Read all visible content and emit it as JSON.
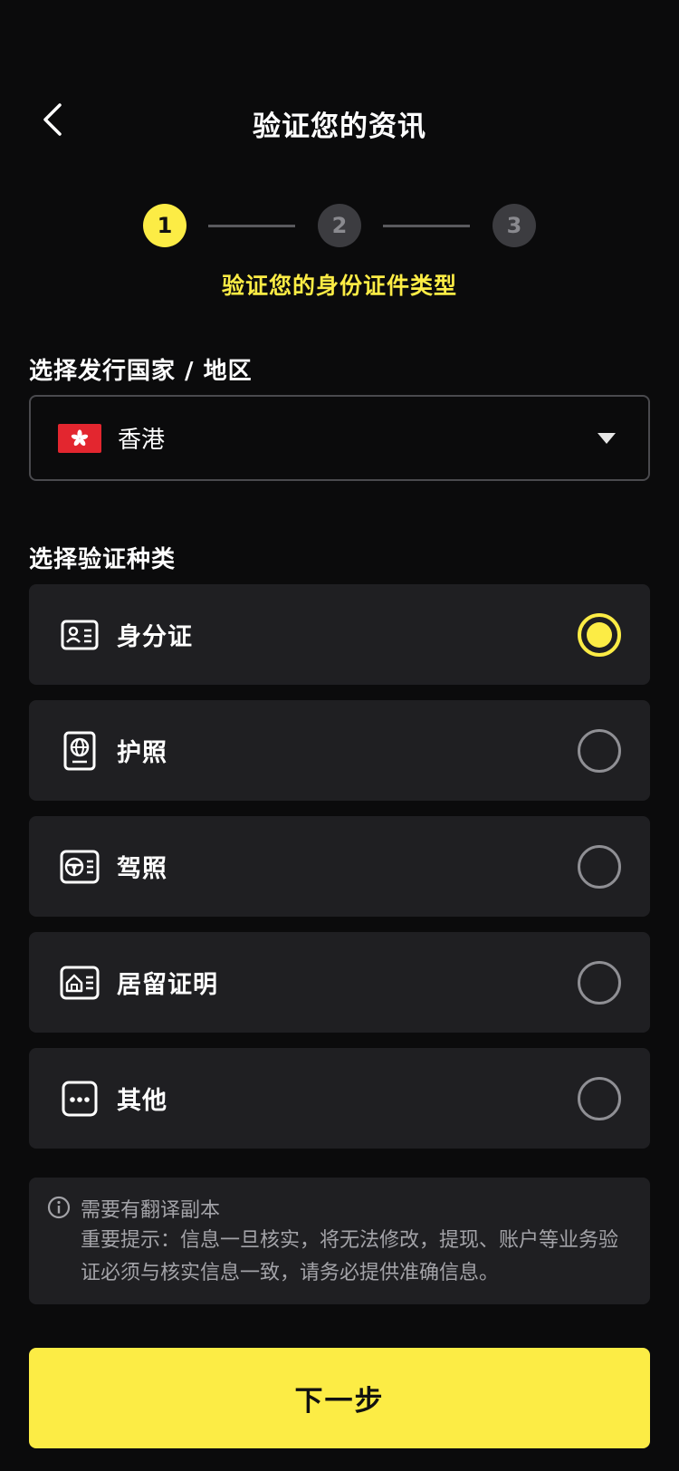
{
  "header": {
    "title": "验证您的资讯"
  },
  "stepper": {
    "steps": [
      "1",
      "2",
      "3"
    ],
    "current": 1,
    "caption": "验证您的身份证件类型"
  },
  "country": {
    "label": "选择发行国家 / 地区",
    "value": "香港"
  },
  "verification": {
    "label": "选择验证种类",
    "options": [
      {
        "label": "身分证",
        "icon": "id-card-icon",
        "selected": true
      },
      {
        "label": "护照",
        "icon": "passport-icon",
        "selected": false
      },
      {
        "label": "驾照",
        "icon": "driver-license-icon",
        "selected": false
      },
      {
        "label": "居留证明",
        "icon": "residence-permit-icon",
        "selected": false
      },
      {
        "label": "其他",
        "icon": "more-icon",
        "selected": false
      }
    ]
  },
  "notice": {
    "title": "需要有翻译副本",
    "body": "重要提示：信息一旦核实，将无法修改，提现、账户等业务验证必须与核实信息一致，请务必提供准确信息。"
  },
  "next_button": {
    "label": "下一步"
  },
  "colors": {
    "background": "#0b0b0c",
    "accent": "#fcec45",
    "card": "#1f1f22",
    "muted_text": "#a3a3a8"
  }
}
